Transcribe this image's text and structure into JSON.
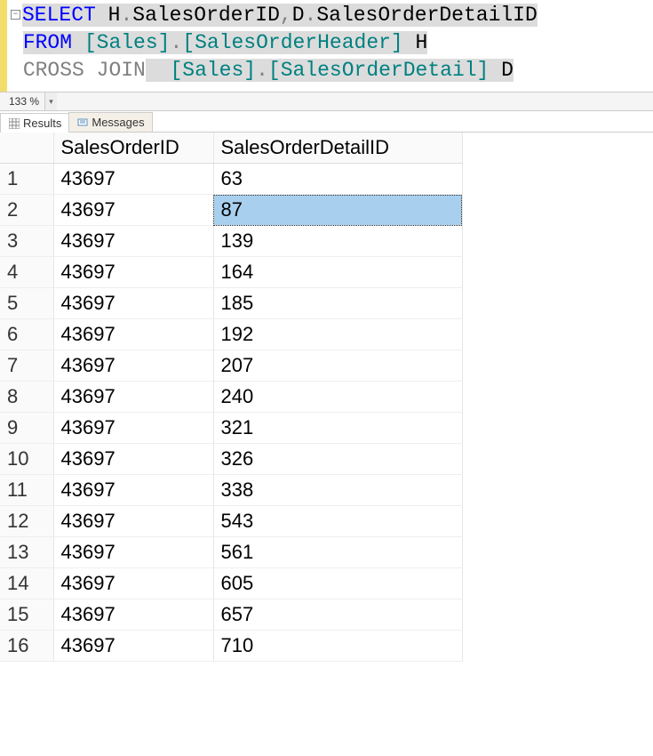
{
  "sql": {
    "tokens_line1": [
      {
        "t": "SELECT",
        "c": "kw-blue",
        "hl": true
      },
      {
        "t": " ",
        "c": "txt",
        "hl": true
      },
      {
        "t": "H",
        "c": "txt",
        "hl": true
      },
      {
        "t": ".",
        "c": "punct",
        "hl": true
      },
      {
        "t": "SalesOrderID",
        "c": "txt",
        "hl": true
      },
      {
        "t": ",",
        "c": "punct",
        "hl": true
      },
      {
        "t": "D",
        "c": "txt",
        "hl": true
      },
      {
        "t": ".",
        "c": "punct",
        "hl": true
      },
      {
        "t": "SalesOrderDetailID",
        "c": "txt",
        "hl": true
      }
    ],
    "tokens_line2": [
      {
        "t": "FROM",
        "c": "kw-blue",
        "hl": true
      },
      {
        "t": " ",
        "c": "txt",
        "hl": true
      },
      {
        "t": "[Sales]",
        "c": "ident-green",
        "hl": true
      },
      {
        "t": ".",
        "c": "punct",
        "hl": true
      },
      {
        "t": "[SalesOrderHeader]",
        "c": "ident-green",
        "hl": true
      },
      {
        "t": " H",
        "c": "txt",
        "hl": true
      },
      {
        "t": " ",
        "c": "txt",
        "hl": false
      }
    ],
    "tokens_line3": [
      {
        "t": "CROSS",
        "c": "kw-gray",
        "hl": false
      },
      {
        "t": " ",
        "c": "txt",
        "hl": false
      },
      {
        "t": "JOIN",
        "c": "kw-gray",
        "hl": false
      },
      {
        "t": "  ",
        "c": "txt",
        "hl": true
      },
      {
        "t": "[Sales]",
        "c": "ident-green",
        "hl": true
      },
      {
        "t": ".",
        "c": "punct",
        "hl": true
      },
      {
        "t": "[SalesOrderDetail]",
        "c": "ident-green",
        "hl": true
      },
      {
        "t": " D",
        "c": "txt",
        "hl": true
      }
    ]
  },
  "zoom": {
    "value": "133 %",
    "dropdown_glyph": "▾"
  },
  "tabs": {
    "results": "Results",
    "messages": "Messages"
  },
  "grid": {
    "columns": [
      "SalesOrderID",
      "SalesOrderDetailID"
    ],
    "selected": {
      "row": 2,
      "col": 1
    },
    "rows": [
      {
        "n": "1",
        "SalesOrderID": "43697",
        "SalesOrderDetailID": "63"
      },
      {
        "n": "2",
        "SalesOrderID": "43697",
        "SalesOrderDetailID": "87"
      },
      {
        "n": "3",
        "SalesOrderID": "43697",
        "SalesOrderDetailID": "139"
      },
      {
        "n": "4",
        "SalesOrderID": "43697",
        "SalesOrderDetailID": "164"
      },
      {
        "n": "5",
        "SalesOrderID": "43697",
        "SalesOrderDetailID": "185"
      },
      {
        "n": "6",
        "SalesOrderID": "43697",
        "SalesOrderDetailID": "192"
      },
      {
        "n": "7",
        "SalesOrderID": "43697",
        "SalesOrderDetailID": "207"
      },
      {
        "n": "8",
        "SalesOrderID": "43697",
        "SalesOrderDetailID": "240"
      },
      {
        "n": "9",
        "SalesOrderID": "43697",
        "SalesOrderDetailID": "321"
      },
      {
        "n": "10",
        "SalesOrderID": "43697",
        "SalesOrderDetailID": "326"
      },
      {
        "n": "11",
        "SalesOrderID": "43697",
        "SalesOrderDetailID": "338"
      },
      {
        "n": "12",
        "SalesOrderID": "43697",
        "SalesOrderDetailID": "543"
      },
      {
        "n": "13",
        "SalesOrderID": "43697",
        "SalesOrderDetailID": "561"
      },
      {
        "n": "14",
        "SalesOrderID": "43697",
        "SalesOrderDetailID": "605"
      },
      {
        "n": "15",
        "SalesOrderID": "43697",
        "SalesOrderDetailID": "657"
      },
      {
        "n": "16",
        "SalesOrderID": "43697",
        "SalesOrderDetailID": "710"
      }
    ]
  }
}
